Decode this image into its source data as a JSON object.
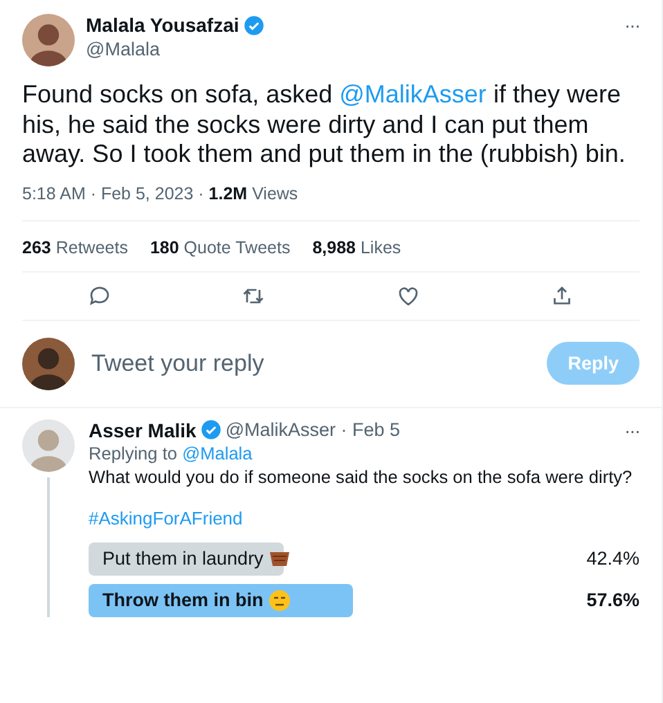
{
  "tweet": {
    "name": "Malala Yousafzai",
    "verified": true,
    "handle": "@Malala",
    "more": "···",
    "text_before": "Found socks on sofa, asked ",
    "mention": "@MalikAsser",
    "text_after": " if they were his, he said the socks were dirty and I can put them away. So I took them and put them in the (rubbish) bin.",
    "time": "5:18 AM · Feb 5, 2023 · ",
    "views_count": "1.2M",
    "views_label": " Views",
    "stats": [
      {
        "count": "263",
        "label": "Retweets"
      },
      {
        "count": "180",
        "label": "Quote Tweets"
      },
      {
        "count": "8,988",
        "label": "Likes"
      }
    ],
    "actions": [
      {
        "kind": "reply"
      },
      {
        "kind": "retweet"
      },
      {
        "kind": "like"
      },
      {
        "kind": "share"
      }
    ]
  },
  "composer": {
    "placeholder": "Tweet your reply",
    "button": "Reply",
    "disabled": true
  },
  "reply": {
    "name": "Asser Malik",
    "verified": true,
    "handle": "@MalikAsser · Feb 5",
    "more": "···",
    "replying_label": "Replying to ",
    "replying_to": "@Malala",
    "text": "What would you do if someone said the socks on the sofa were dirty?",
    "hashtag": "#AskingForAFriend",
    "poll": [
      {
        "label": "Put them in laundry",
        "kind": "basket",
        "percent": "42.4%",
        "selected": false
      },
      {
        "label": "Throw them in bin",
        "kind": "face",
        "percent": "57.6%",
        "selected": true
      }
    ]
  }
}
